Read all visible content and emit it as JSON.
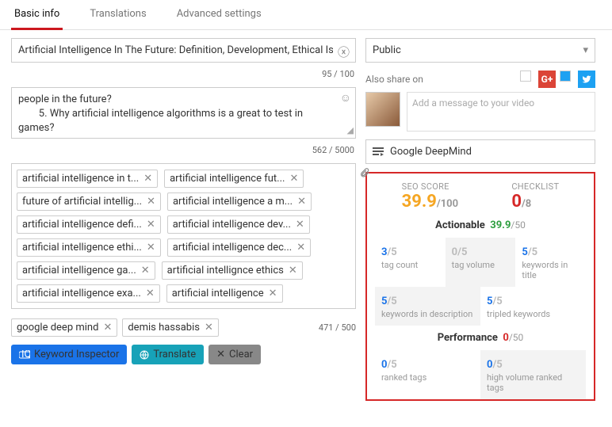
{
  "tabs": [
    {
      "label": "Basic info",
      "active": true
    },
    {
      "label": "Translations",
      "active": false
    },
    {
      "label": "Advanced settings",
      "active": false
    }
  ],
  "title": {
    "value": "Artificial Intelligence In The Future: Definition, Development, Ethical Iss",
    "counter": "95 / 100"
  },
  "description": {
    "text": "people in the future?\n        5. Why artificial intelligence algorithms is a great to test in games?",
    "counter": "562 / 5000"
  },
  "tags": [
    "artificial intelligence in t...",
    "artificial intelligence fut...",
    "future of artificial intellig...",
    "artificial intelligence a m...",
    "artificial intelligence defi...",
    "artificial intelligence dev...",
    "artificial intelligence ethi...",
    "artificial intelligence dec...",
    "artificial intelligence ga...",
    "artificial intellignce ethics",
    "artificial intelligence exa...",
    "artificial intelligence"
  ],
  "tags_secondary": [
    "google deep mind",
    "demis hassabis"
  ],
  "tag_counter": "471 / 500",
  "buttons": {
    "inspector": "Keyword Inspector",
    "translate": "Translate",
    "clear": "Clear"
  },
  "visibility": "Public",
  "share": {
    "label": "Also share on",
    "placeholder": "Add a message to your video"
  },
  "playlist": "Google DeepMind",
  "seo": {
    "score": {
      "label": "SEO SCORE",
      "value": "39.9",
      "denom": "/100"
    },
    "checklist": {
      "label": "CHECKLIST",
      "value": "0",
      "denom": "/8"
    },
    "actionable": {
      "title": "Actionable",
      "score": "39.9",
      "denom": "/50"
    },
    "performance": {
      "title": "Performance",
      "score": "0",
      "denom": "/50"
    },
    "cells": [
      {
        "v": "3",
        "d": "/5",
        "l": "tag count",
        "c": "blue",
        "shade": false
      },
      {
        "v": "0",
        "d": "/5",
        "l": "tag volume",
        "c": "grey",
        "shade": true
      },
      {
        "v": "5",
        "d": "/5",
        "l": "keywords in title",
        "c": "blue",
        "shade": false
      },
      {
        "v": "5",
        "d": "/5",
        "l": "keywords in description",
        "c": "blue",
        "shade": true,
        "half": true
      },
      {
        "v": "5",
        "d": "/5",
        "l": "tripled keywords",
        "c": "blue",
        "shade": false,
        "half": true
      }
    ],
    "perf_cells": [
      {
        "v": "0",
        "d": "/5",
        "l": "ranked tags",
        "c": "blue",
        "shade": false,
        "half": true
      },
      {
        "v": "0",
        "d": "/5",
        "l": "high volume ranked tags",
        "c": "blue",
        "shade": true,
        "half": true
      }
    ]
  }
}
